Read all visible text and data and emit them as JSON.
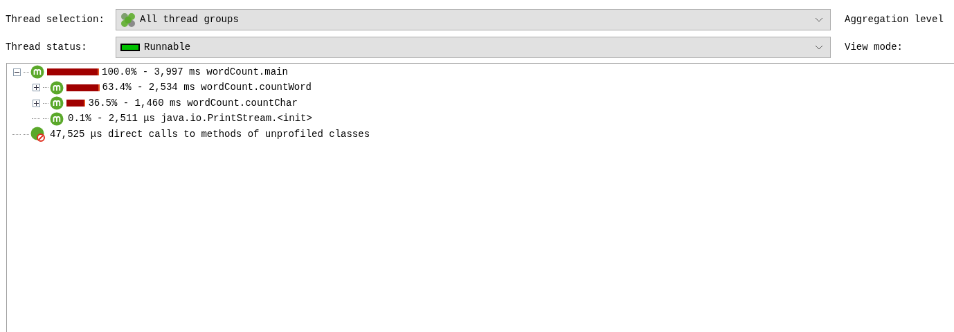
{
  "filters": [
    {
      "label": "Thread selection:",
      "value": "All thread groups",
      "side_label": "Aggregation level"
    },
    {
      "label": "Thread status:",
      "value": "Runnable",
      "side_label": "View mode:"
    }
  ],
  "tree": [
    {
      "kind": "method",
      "expanded": true,
      "text": "100.0% - 3,997 ms wordCount.main",
      "children": [
        {
          "kind": "method",
          "expanded": false,
          "text": "63.4% - 2,534 ms wordCount.countWord"
        },
        {
          "kind": "method",
          "expanded": false,
          "text": "36.5% - 1,460 ms wordCount.countChar"
        },
        {
          "kind": "method",
          "text": "0.1% - 2,511 μs java.io.PrintStream.<init>"
        }
      ]
    },
    {
      "kind": "unprofiled",
      "text": "47,525 μs direct calls to methods of unprofiled classes"
    }
  ]
}
